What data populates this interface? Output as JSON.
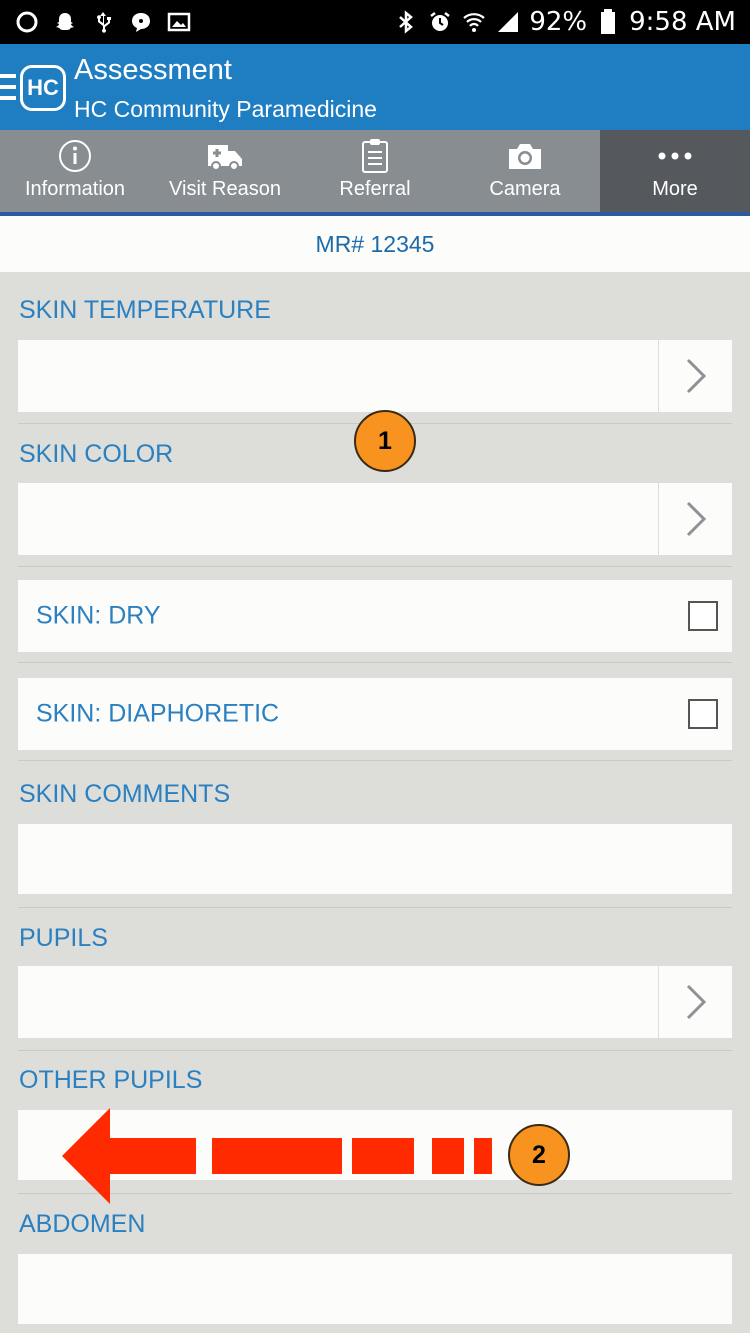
{
  "status_bar": {
    "left_icons": [
      "circle-icon",
      "snapchat-icon",
      "usb-icon",
      "message-icon",
      "image-icon"
    ],
    "battery": "92%",
    "time": "9:58 AM"
  },
  "header": {
    "logo_text": "HC",
    "title": "Assessment",
    "subtitle": "HC Community Paramedicine"
  },
  "tabs": [
    {
      "label": "Information",
      "icon": "info-icon"
    },
    {
      "label": "Visit Reason",
      "icon": "ambulance-icon"
    },
    {
      "label": "Referral",
      "icon": "clipboard-icon"
    },
    {
      "label": "Camera",
      "icon": "camera-icon"
    },
    {
      "label": "More",
      "icon": "more-icon"
    }
  ],
  "record": {
    "mr": "MR# 12345"
  },
  "form": {
    "skin_temperature": {
      "label": "SKIN TEMPERATURE",
      "value": ""
    },
    "skin_color": {
      "label": "SKIN COLOR",
      "value": ""
    },
    "skin_dry": {
      "label": "SKIN: DRY",
      "checked": false
    },
    "skin_diaphoretic": {
      "label": "SKIN: DIAPHORETIC",
      "checked": false
    },
    "skin_comments": {
      "label": "SKIN COMMENTS",
      "value": ""
    },
    "pupils": {
      "label": "PUPILS",
      "value": ""
    },
    "other_pupils": {
      "label": "OTHER PUPILS",
      "value": ""
    },
    "abdomen": {
      "label": "ABDOMEN",
      "value": ""
    }
  },
  "callouts": {
    "one": "1",
    "two": "2"
  },
  "colors": {
    "accent": "#1f7dc1",
    "tab_bar": "#888d92",
    "callout": "#f7931e",
    "arrow": "#ff2a00"
  }
}
